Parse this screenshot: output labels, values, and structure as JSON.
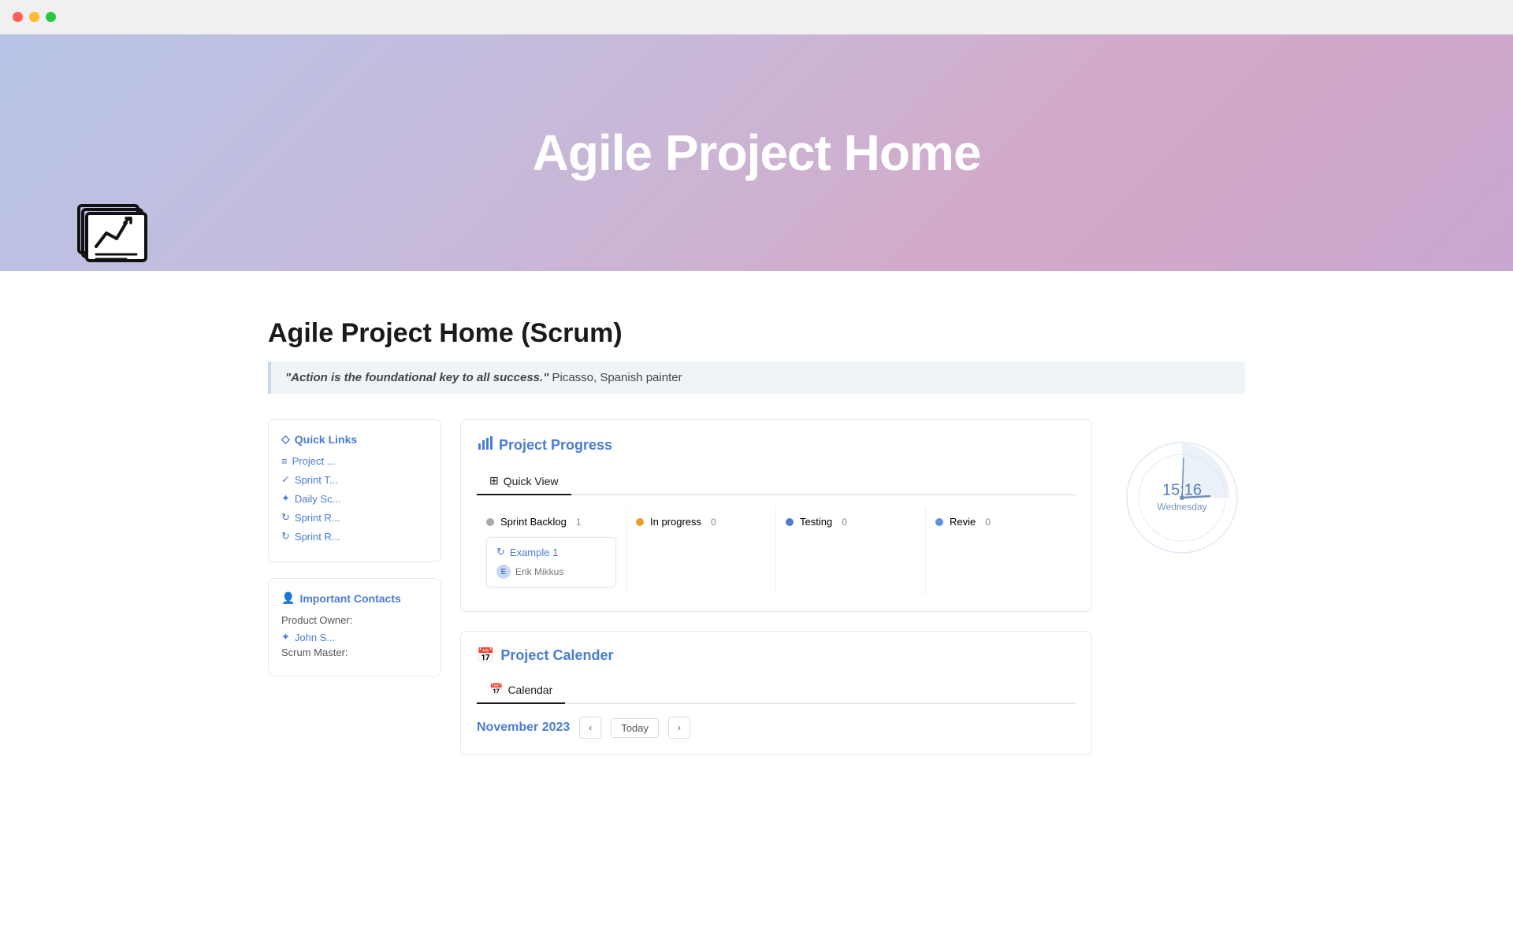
{
  "titlebar": {
    "traffic_lights": [
      "red",
      "yellow",
      "green"
    ]
  },
  "hero": {
    "title": "Agile Project Home",
    "icon": "📋"
  },
  "page": {
    "title": "Agile Project Home (Scrum)",
    "quote": {
      "text": "\"Action is the foundational key to all success.\"",
      "attribution": " Picasso, Spanish painter"
    }
  },
  "sidebar": {
    "quick_links": {
      "title": "Quick Links",
      "links": [
        {
          "label": "Project ...",
          "icon": "≡"
        },
        {
          "label": "Sprint T...",
          "icon": "✓"
        },
        {
          "label": "Daily Sc...",
          "icon": "🎨"
        },
        {
          "label": "Sprint R...",
          "icon": "↻"
        },
        {
          "label": "Sprint R...",
          "icon": "↻"
        }
      ]
    },
    "contacts": {
      "title": "Important Contacts",
      "product_owner_label": "Product Owner:",
      "product_owner_link": "John S...",
      "scrum_master_label": "Scrum Master:"
    }
  },
  "project_progress": {
    "section_title": "Project Progress",
    "tab_label": "Quick View",
    "tab_icon": "⊞",
    "columns": [
      {
        "name": "Sprint Backlog",
        "count": 1,
        "dot_class": "dot-gray",
        "cards": [
          {
            "title": "Example 1",
            "assignee": "Erik Mikkus",
            "avatar_initials": "E"
          }
        ]
      },
      {
        "name": "In progress",
        "count": 0,
        "dot_class": "dot-yellow",
        "cards": []
      },
      {
        "name": "Testing",
        "count": 0,
        "dot_class": "dot-blue",
        "cards": []
      },
      {
        "name": "Revie",
        "count": 0,
        "dot_class": "dot-blue2",
        "cards": []
      }
    ]
  },
  "clock": {
    "time": "15:16",
    "day": "Wednesday"
  },
  "project_calendar": {
    "section_title": "Project Calender",
    "tab_label": "Calendar",
    "tab_icon": "📅",
    "month": "November 2023",
    "today_label": "Today"
  }
}
